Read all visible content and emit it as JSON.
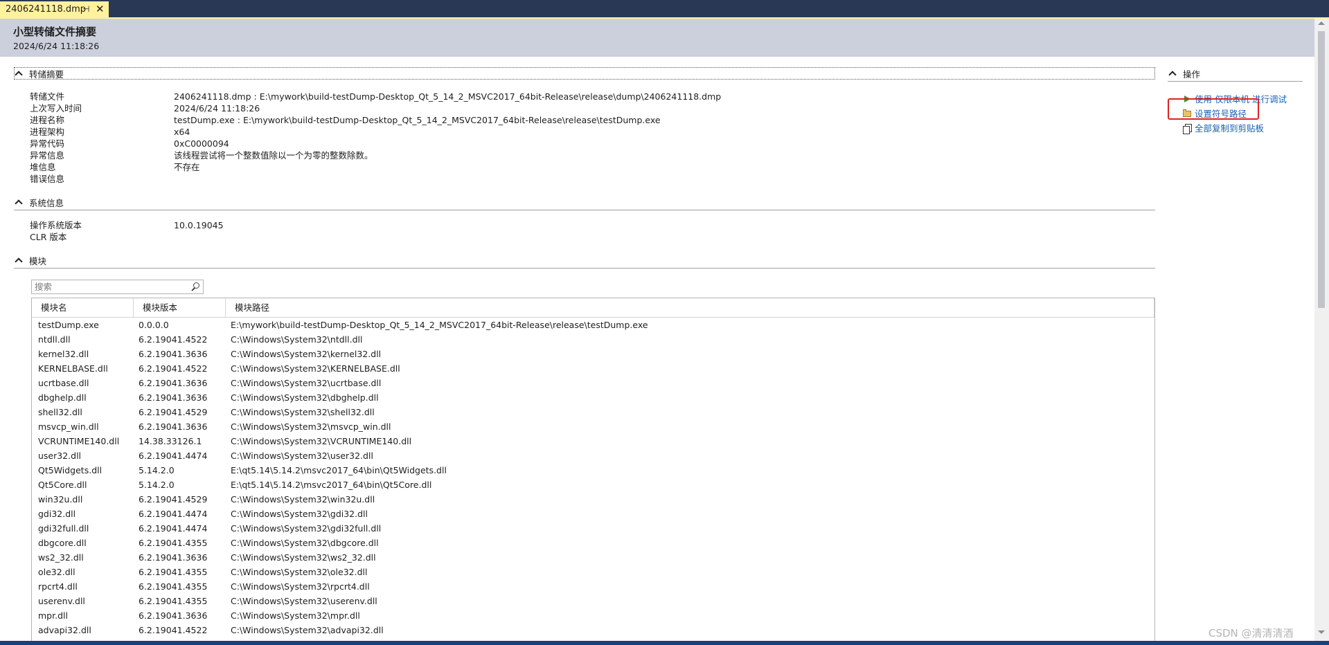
{
  "tab": {
    "label": "2406241118.dmp",
    "pin_glyph": "⊣",
    "close_glyph": "✕"
  },
  "header": {
    "title": "小型转储文件摘要",
    "date": "2024/6/24 11:18:26"
  },
  "dump_summary": {
    "heading": "转储摘要",
    "rows": [
      {
        "key": "转储文件",
        "value": "2406241118.dmp : E:\\mywork\\build-testDump-Desktop_Qt_5_14_2_MSVC2017_64bit-Release\\release\\dump\\2406241118.dmp"
      },
      {
        "key": "上次写入时间",
        "value": "2024/6/24 11:18:26"
      },
      {
        "key": "进程名称",
        "value": "testDump.exe : E:\\mywork\\build-testDump-Desktop_Qt_5_14_2_MSVC2017_64bit-Release\\release\\testDump.exe"
      },
      {
        "key": "进程架构",
        "value": "x64"
      },
      {
        "key": "异常代码",
        "value": "0xC0000094"
      },
      {
        "key": "异常信息",
        "value": "该线程尝试将一个整数值除以一个为零的整数除数。"
      },
      {
        "key": "堆信息",
        "value": "不存在"
      },
      {
        "key": "错误信息",
        "value": ""
      }
    ]
  },
  "system_info": {
    "heading": "系统信息",
    "rows": [
      {
        "key": "操作系统版本",
        "value": "10.0.19045"
      },
      {
        "key": "CLR 版本",
        "value": ""
      }
    ]
  },
  "modules": {
    "heading": "模块",
    "search_placeholder": "搜索",
    "columns": [
      "模块名",
      "模块版本",
      "模块路径"
    ],
    "rows": [
      [
        "testDump.exe",
        "0.0.0.0",
        "E:\\mywork\\build-testDump-Desktop_Qt_5_14_2_MSVC2017_64bit-Release\\release\\testDump.exe"
      ],
      [
        "ntdll.dll",
        "6.2.19041.4522",
        "C:\\Windows\\System32\\ntdll.dll"
      ],
      [
        "kernel32.dll",
        "6.2.19041.3636",
        "C:\\Windows\\System32\\kernel32.dll"
      ],
      [
        "KERNELBASE.dll",
        "6.2.19041.4522",
        "C:\\Windows\\System32\\KERNELBASE.dll"
      ],
      [
        "ucrtbase.dll",
        "6.2.19041.3636",
        "C:\\Windows\\System32\\ucrtbase.dll"
      ],
      [
        "dbghelp.dll",
        "6.2.19041.3636",
        "C:\\Windows\\System32\\dbghelp.dll"
      ],
      [
        "shell32.dll",
        "6.2.19041.4529",
        "C:\\Windows\\System32\\shell32.dll"
      ],
      [
        "msvcp_win.dll",
        "6.2.19041.3636",
        "C:\\Windows\\System32\\msvcp_win.dll"
      ],
      [
        "VCRUNTIME140.dll",
        "14.38.33126.1",
        "C:\\Windows\\System32\\VCRUNTIME140.dll"
      ],
      [
        "user32.dll",
        "6.2.19041.4474",
        "C:\\Windows\\System32\\user32.dll"
      ],
      [
        "Qt5Widgets.dll",
        "5.14.2.0",
        "E:\\qt5.14\\5.14.2\\msvc2017_64\\bin\\Qt5Widgets.dll"
      ],
      [
        "Qt5Core.dll",
        "5.14.2.0",
        "E:\\qt5.14\\5.14.2\\msvc2017_64\\bin\\Qt5Core.dll"
      ],
      [
        "win32u.dll",
        "6.2.19041.4529",
        "C:\\Windows\\System32\\win32u.dll"
      ],
      [
        "gdi32.dll",
        "6.2.19041.4474",
        "C:\\Windows\\System32\\gdi32.dll"
      ],
      [
        "gdi32full.dll",
        "6.2.19041.4474",
        "C:\\Windows\\System32\\gdi32full.dll"
      ],
      [
        "dbgcore.dll",
        "6.2.19041.4355",
        "C:\\Windows\\System32\\dbgcore.dll"
      ],
      [
        "ws2_32.dll",
        "6.2.19041.3636",
        "C:\\Windows\\System32\\ws2_32.dll"
      ],
      [
        "ole32.dll",
        "6.2.19041.4355",
        "C:\\Windows\\System32\\ole32.dll"
      ],
      [
        "rpcrt4.dll",
        "6.2.19041.4355",
        "C:\\Windows\\System32\\rpcrt4.dll"
      ],
      [
        "userenv.dll",
        "6.2.19041.4355",
        "C:\\Windows\\System32\\userenv.dll"
      ],
      [
        "mpr.dll",
        "6.2.19041.3636",
        "C:\\Windows\\System32\\mpr.dll"
      ],
      [
        "advapi32.dll",
        "6.2.19041.4522",
        "C:\\Windows\\System32\\advapi32.dll"
      ]
    ]
  },
  "actions": {
    "heading": "操作",
    "items": [
      {
        "label": "使用 仅限本机 进行调试",
        "icon": "play-icon"
      },
      {
        "label": "设置符号路径",
        "icon": "folder-icon"
      },
      {
        "label": "全部复制到剪贴板",
        "icon": "copy-icon"
      }
    ]
  },
  "watermark": "CSDN @清清清酒",
  "colors": {
    "tab_active": "#fff29d",
    "titlebar": "#293955",
    "header_band": "#ccd0dd",
    "link": "#1a5fb4",
    "highlight": "#e02020"
  }
}
